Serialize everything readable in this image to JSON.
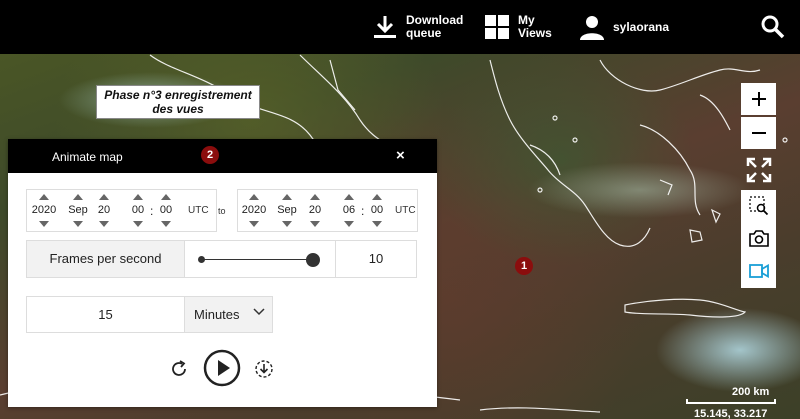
{
  "topbar": {
    "download_label": "Download queue",
    "download_line1": "Download",
    "download_line2": "queue",
    "views_line1": "My",
    "views_line2": "Views",
    "user_name": "sylaorana"
  },
  "caption": {
    "line1": "Phase n°3 enregistrement",
    "line2": "des vues"
  },
  "markers": {
    "map_marker": "1",
    "panel_marker": "2",
    "color": "#8b0d0d"
  },
  "panel": {
    "title": "Animate map",
    "close": "×",
    "start": {
      "year": "2020",
      "month": "Sep",
      "day": "20",
      "hour": "00",
      "minute": "00",
      "tz": "UTC"
    },
    "to_label": "to",
    "end": {
      "year": "2020",
      "month": "Sep",
      "day": "20",
      "hour": "06",
      "minute": "00",
      "tz": "UTC"
    },
    "fps_label": "Frames per second",
    "fps_value": "10",
    "fps_slider_fraction": 1.0,
    "step_value": "15",
    "step_unit": "Minutes"
  },
  "map": {
    "scale_label": "200 km",
    "coords": "15.145, 33.217"
  },
  "colors": {
    "accent": "#1a9fd6",
    "topbar": "#000000"
  }
}
